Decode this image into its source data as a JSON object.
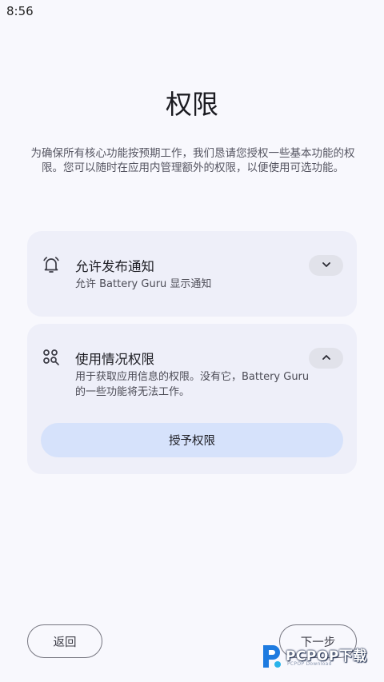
{
  "status_bar": {
    "time": "8:56"
  },
  "header": {
    "title": "权限",
    "description": "为确保所有核心功能按预期工作，我们恳请您授权一些基本功能的权限。您可以随时在应用内管理额外的权限，以便使用可选功能。"
  },
  "permissions": [
    {
      "title": "允许发布通知",
      "subtitle": "允许 Battery Guru 显示通知",
      "icon": "bell-icon",
      "expanded": false,
      "toggle_icon": "chevron-down-icon"
    },
    {
      "title": "使用情况权限",
      "subtitle": "用于获取应用信息的权限。没有它，Battery Guru 的一些功能将无法工作。",
      "icon": "apps-search-icon",
      "expanded": true,
      "toggle_icon": "chevron-up-icon",
      "action_label": "授予权限"
    }
  ],
  "footer": {
    "back_label": "返回",
    "next_label": "下一步"
  },
  "watermark": {
    "brand": "PCPOP下载",
    "tagline": "PCPOP Download"
  },
  "colors": {
    "background": "#f8f8fd",
    "card": "#eeeff9",
    "primary_button": "#d6e2fb",
    "chevron_button": "#e1e2ea"
  }
}
